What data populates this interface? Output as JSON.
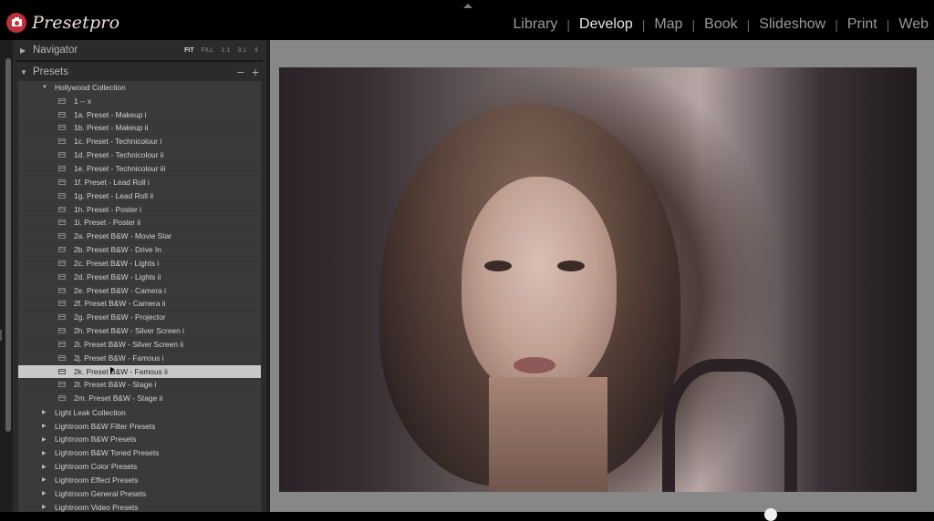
{
  "app": {
    "brand": "Presetpro",
    "accent_color": "#c0303a"
  },
  "modules": [
    {
      "label": "Library",
      "active": false
    },
    {
      "label": "Develop",
      "active": true
    },
    {
      "label": "Map",
      "active": false
    },
    {
      "label": "Book",
      "active": false
    },
    {
      "label": "Slideshow",
      "active": false
    },
    {
      "label": "Print",
      "active": false
    },
    {
      "label": "Web",
      "active": false
    }
  ],
  "navigator": {
    "title": "Navigator",
    "zoom_options": [
      "FIT",
      "FILL",
      "1:1",
      "3:1"
    ],
    "zoom_selected": "FIT",
    "stepper_glyph": "⇕"
  },
  "presets": {
    "title": "Presets",
    "remove_glyph": "−",
    "add_glyph": "+",
    "open_collection": "Hollywood Collection",
    "items": [
      "1 -- x",
      "1a. Preset - Makeup i",
      "1b. Preset - Makeup ii",
      "1c. Preset - Technicolour i",
      "1d. Preset - Technicolour ii",
      "1e. Preset - Technicolour iii",
      "1f. Preset - Lead Roll i",
      "1g. Preset - Lead Roll ii",
      "1h. Preset - Poster i",
      "1i. Preset - Poster ii",
      "2a. Preset B&W - Movie Star",
      "2b. Preset B&W - Drive In",
      "2c. Preset B&W - Lights i",
      "2d. Preset B&W - Lights ii",
      "2e. Preset B&W - Camera i",
      "2f. Preset B&W - Camera ii",
      "2g. Preset B&W - Projector",
      "2h. Preset B&W - Silver Screen i",
      "2i. Preset B&W - Silver Screen ii",
      "2j. Preset B&W - Famous i",
      "2k. Preset B&W - Famous ii",
      "2l. Preset B&W - Stage i",
      "2m. Preset B&W - Stage ii"
    ],
    "selected_item": "2k. Preset B&W - Famous ii",
    "collapsed_collections": [
      "Light Leak Collection",
      "Lightroom B&W Filter Presets",
      "Lightroom B&W Presets",
      "Lightroom B&W Toned Presets",
      "Lightroom Color Presets",
      "Lightroom Effect Presets",
      "Lightroom General Presets",
      "Lightroom Video Presets"
    ]
  },
  "icons": {
    "expanded": "▼",
    "collapsed": "▶"
  },
  "photo": {
    "description": "Toned black-and-white portrait of a woman with wavy hair"
  }
}
